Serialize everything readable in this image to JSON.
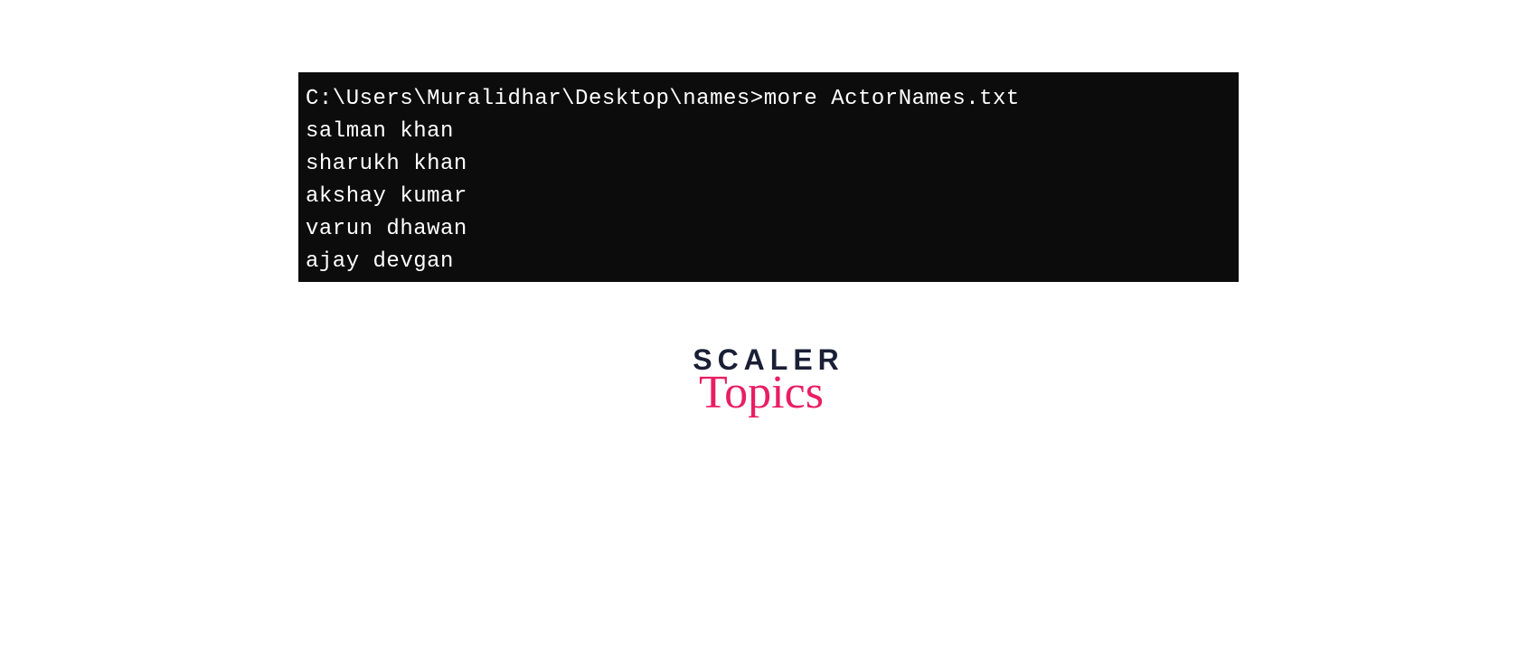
{
  "terminal": {
    "prompt": "C:\\Users\\Muralidhar\\Desktop\\names>",
    "command": "more ActorNames.txt",
    "output": [
      "salman khan",
      "sharukh khan",
      "akshay kumar",
      "varun dhawan",
      "ajay devgan"
    ]
  },
  "logo": {
    "main": "SCALER",
    "sub": "Topics"
  }
}
